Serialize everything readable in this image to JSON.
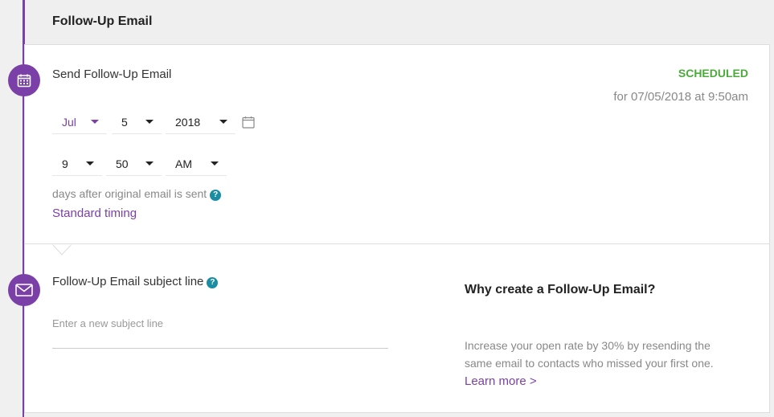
{
  "header": {
    "title": "Follow-Up Email"
  },
  "schedule": {
    "section_title": "Send Follow-Up Email",
    "status": "SCHEDULED",
    "scheduled_for": "for 07/05/2018 at 9:50am",
    "date": {
      "month": "Jul",
      "day": "5",
      "year": "2018"
    },
    "time": {
      "hour": "9",
      "minute": "50",
      "ampm": "AM"
    },
    "help_text": "days after original email is sent",
    "standard_timing_link": "Standard timing"
  },
  "subject": {
    "label": "Follow-Up Email subject line",
    "placeholder": "Enter a new subject line"
  },
  "info": {
    "title": "Why create a Follow-Up Email?",
    "body": "Increase your open rate by 30% by resending the same email to contacts who missed your first one.",
    "learn_more": "Learn more >"
  },
  "colors": {
    "accent": "#7b3fa8",
    "status_green": "#4caa3b",
    "help_teal": "#1a8da3"
  },
  "icons": {
    "schedule": "calendar-icon",
    "subject": "envelope-icon",
    "help": "help-icon"
  }
}
